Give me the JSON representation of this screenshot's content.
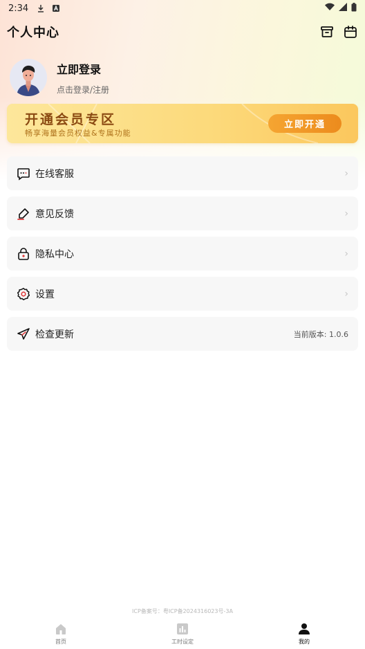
{
  "status_bar": {
    "time": "2:34"
  },
  "header": {
    "title": "个人中心"
  },
  "profile": {
    "name": "立即登录",
    "subtitle": "点击登录/注册"
  },
  "vip_banner": {
    "title": "开通会员专区",
    "subtitle": "畅享海量会员权益&专属功能",
    "button_label": "立即开通"
  },
  "menu": {
    "items": [
      {
        "label": "在线客服",
        "icon": "chat-icon"
      },
      {
        "label": "意见反馈",
        "icon": "edit-icon"
      },
      {
        "label": "隐私中心",
        "icon": "lock-icon"
      },
      {
        "label": "设置",
        "icon": "gear-icon"
      },
      {
        "label": "检查更新",
        "icon": "paper-plane-icon",
        "version": "当前版本: 1.0.6"
      }
    ]
  },
  "footer": {
    "icp": "ICP备案号：粤ICP备2024316023号-3A"
  },
  "tabbar": {
    "tabs": [
      {
        "label": "首页",
        "icon": "home-icon"
      },
      {
        "label": "工时设定",
        "icon": "chart-icon"
      },
      {
        "label": "我的",
        "icon": "user-icon",
        "active": true
      }
    ]
  },
  "colors": {
    "accent": "#ec8b1d",
    "banner_text": "#8b4a12",
    "menu_bg": "#f7f7f7"
  }
}
